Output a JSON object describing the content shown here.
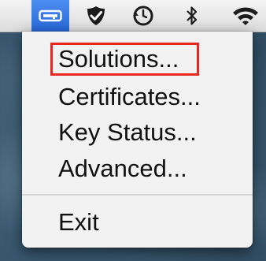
{
  "menubar": {
    "icons": [
      {
        "name": "key-icon",
        "active": true
      },
      {
        "name": "shield-check-icon",
        "active": false
      },
      {
        "name": "time-machine-icon",
        "active": false
      },
      {
        "name": "bluetooth-icon",
        "active": false
      },
      {
        "name": "wifi-icon",
        "active": false
      }
    ],
    "active_color": "#2f72e0"
  },
  "menu": {
    "items": [
      {
        "label": "Solutions...",
        "highlighted": true
      },
      {
        "label": "Certificates..."
      },
      {
        "label": "Key Status..."
      },
      {
        "label": "Advanced..."
      },
      {
        "label": "Exit"
      }
    ],
    "highlight_color": "#e8261e"
  }
}
